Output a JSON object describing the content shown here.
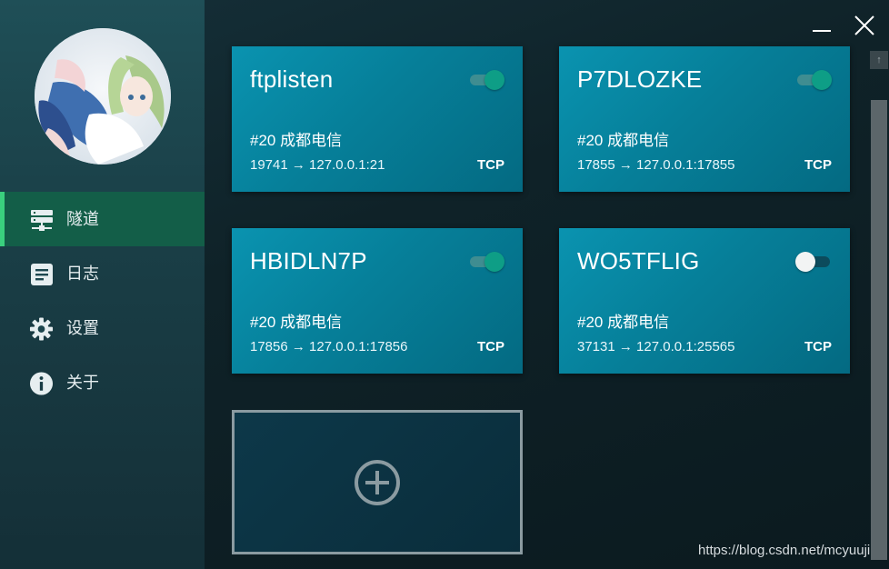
{
  "nav": {
    "items": [
      {
        "label": "隧道",
        "icon": "server-icon",
        "active": true
      },
      {
        "label": "日志",
        "icon": "document-icon",
        "active": false
      },
      {
        "label": "设置",
        "icon": "gear-icon",
        "active": false
      },
      {
        "label": "关于",
        "icon": "info-icon",
        "active": false
      }
    ]
  },
  "window_controls": {
    "minimize": "minimize-icon",
    "close": "close-icon"
  },
  "tunnels": [
    {
      "name": "ftplisten",
      "region": "#20 成都电信",
      "mapping": "19741 → 127.0.0.1:21",
      "protocol": "TCP",
      "enabled": true
    },
    {
      "name": "P7DLOZKE",
      "region": "#20 成都电信",
      "mapping": "17855 → 127.0.0.1:17855",
      "protocol": "TCP",
      "enabled": true
    },
    {
      "name": "HBIDLN7P",
      "region": "#20 成都电信",
      "mapping": "17856 → 127.0.0.1:17856",
      "protocol": "TCP",
      "enabled": true
    },
    {
      "name": "WO5TFLIG",
      "region": "#20 成都电信",
      "mapping": "37131 → 127.0.0.1:25565",
      "protocol": "TCP",
      "enabled": false
    }
  ],
  "add_card": {
    "icon": "plus-circle-icon"
  },
  "watermark": "https://blog.csdn.net/mcyuuji",
  "colors": {
    "accent_active": "#3ad07e",
    "card": "#0a93b0",
    "toggle_on": "#0e9e86"
  }
}
